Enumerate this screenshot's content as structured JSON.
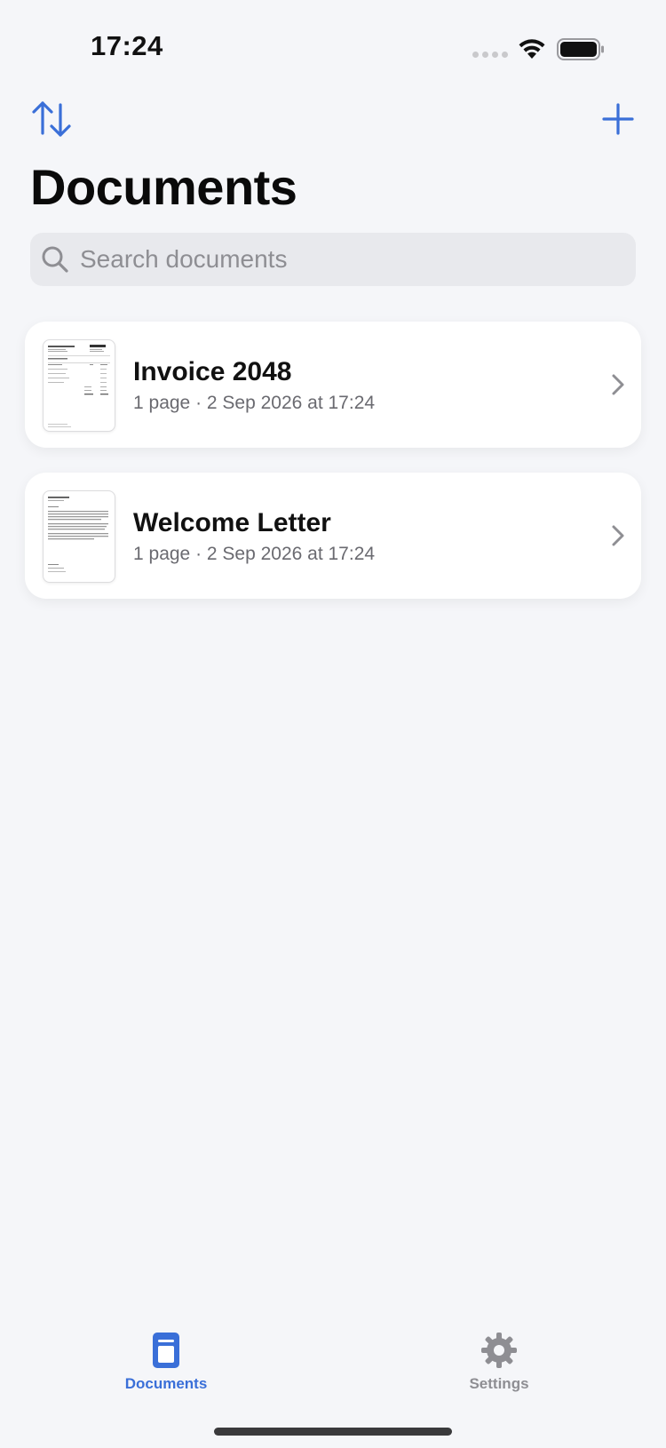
{
  "status_bar": {
    "time": "17:24"
  },
  "nav": {
    "sort_icon": "arrow-up-down-icon",
    "add_icon": "plus-icon"
  },
  "page": {
    "title": "Documents"
  },
  "search": {
    "placeholder": "Search documents",
    "value": ""
  },
  "documents": [
    {
      "name": "Invoice 2048",
      "meta": "1 page · 2 Sep 2026 at 17:24",
      "thumbnail": "invoice-thumbnail"
    },
    {
      "name": "Welcome Letter",
      "meta": "1 page · 2 Sep 2026 at 17:24",
      "thumbnail": "letter-thumbnail"
    }
  ],
  "tabs": [
    {
      "label": "Documents",
      "icon": "document-icon",
      "active": true
    },
    {
      "label": "Settings",
      "icon": "gear-icon",
      "active": false
    }
  ],
  "colors": {
    "accent": "#3a6fd8",
    "background": "#f5f6f9",
    "inactive": "#8e8e93"
  }
}
